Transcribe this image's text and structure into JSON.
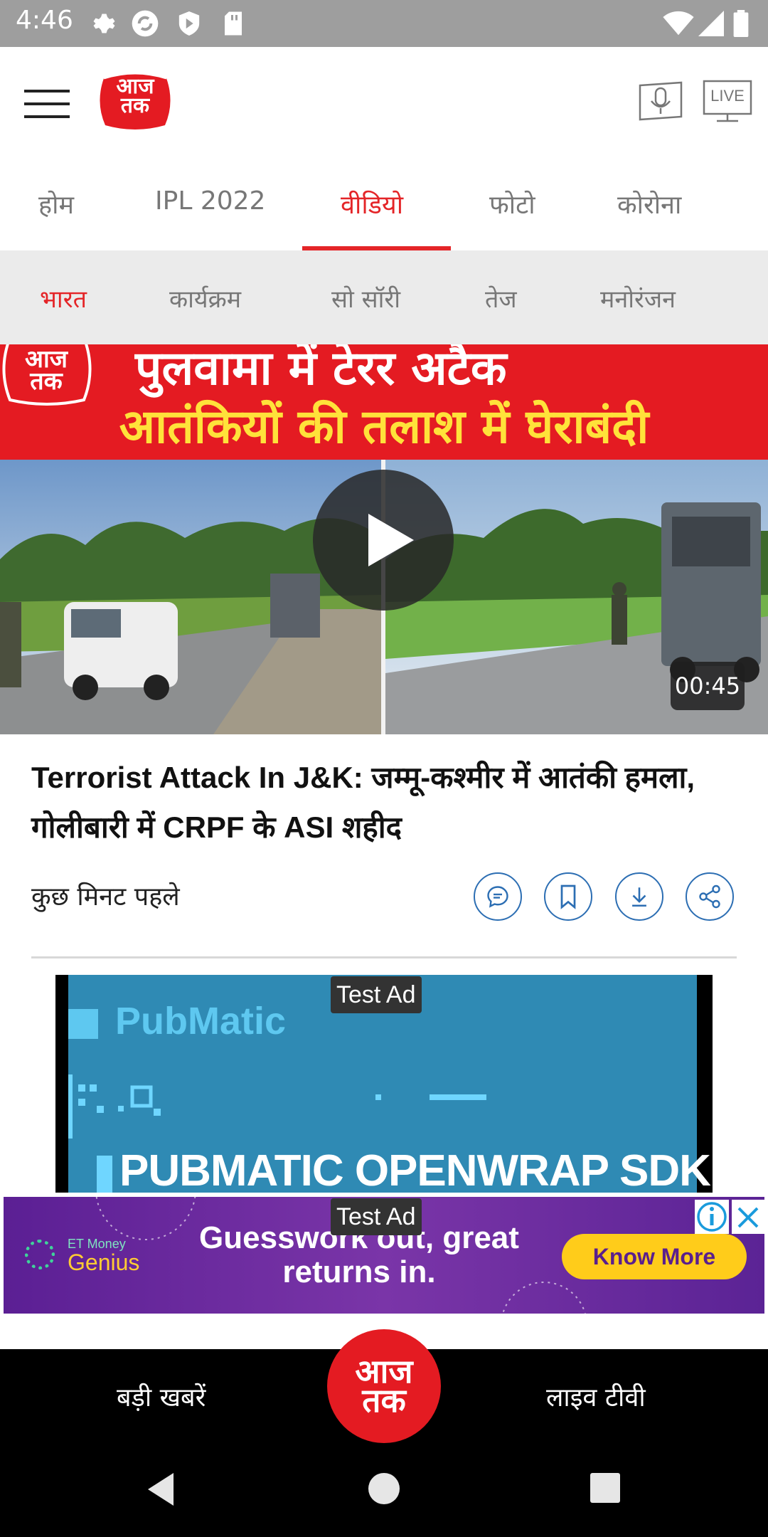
{
  "status_bar": {
    "time": "4:46"
  },
  "header": {
    "menu_icon": "hamburger-menu-icon",
    "logo_text": "आज तक",
    "podcast_icon": "microphone-icon",
    "live_label": "LIVE"
  },
  "tabs": [
    {
      "label": "होम",
      "active": false
    },
    {
      "label": "IPL 2022",
      "active": false
    },
    {
      "label": "वीडियो",
      "active": true
    },
    {
      "label": "फोटो",
      "active": false
    },
    {
      "label": "कोरोना",
      "active": false
    }
  ],
  "subnav": [
    {
      "label": "भारत",
      "active": true
    },
    {
      "label": "कार्यक्रम",
      "active": false
    },
    {
      "label": "सो सॉरी",
      "active": false
    },
    {
      "label": "तेज",
      "active": false
    },
    {
      "label": "मनोरंजन",
      "active": false
    }
  ],
  "video": {
    "banner_line1": "पुलवामा में टेरर अटैक",
    "banner_line2": "आतंकियों की तलाश में घेराबंदी",
    "duration": "00:45"
  },
  "article": {
    "headline": "Terrorist Attack In J&K:  जम्मू-कश्मीर में आतंकी हमला, गोलीबारी में CRPF के ASI शहीद",
    "time_ago": "कुछ मिनट पहले"
  },
  "ad1": {
    "label": "Test Ad",
    "brand": "PubMatic",
    "headline": "PUBMATIC OPENWRAP SDK"
  },
  "ad2": {
    "label": "Test Ad",
    "brand_line1": "ET Money",
    "brand_line2": "Genius",
    "text_line1": "Guesswork out, great",
    "text_line2": "returns in.",
    "cta": "Know More"
  },
  "bottom_nav": {
    "left_label": "बड़ी खबरें",
    "center_logo": "आज तक",
    "right_label": "लाइव टीवी"
  },
  "colors": {
    "brand_red": "#e42528",
    "link_blue": "#2c6eb3",
    "status_bar": "#9e9e9e"
  }
}
